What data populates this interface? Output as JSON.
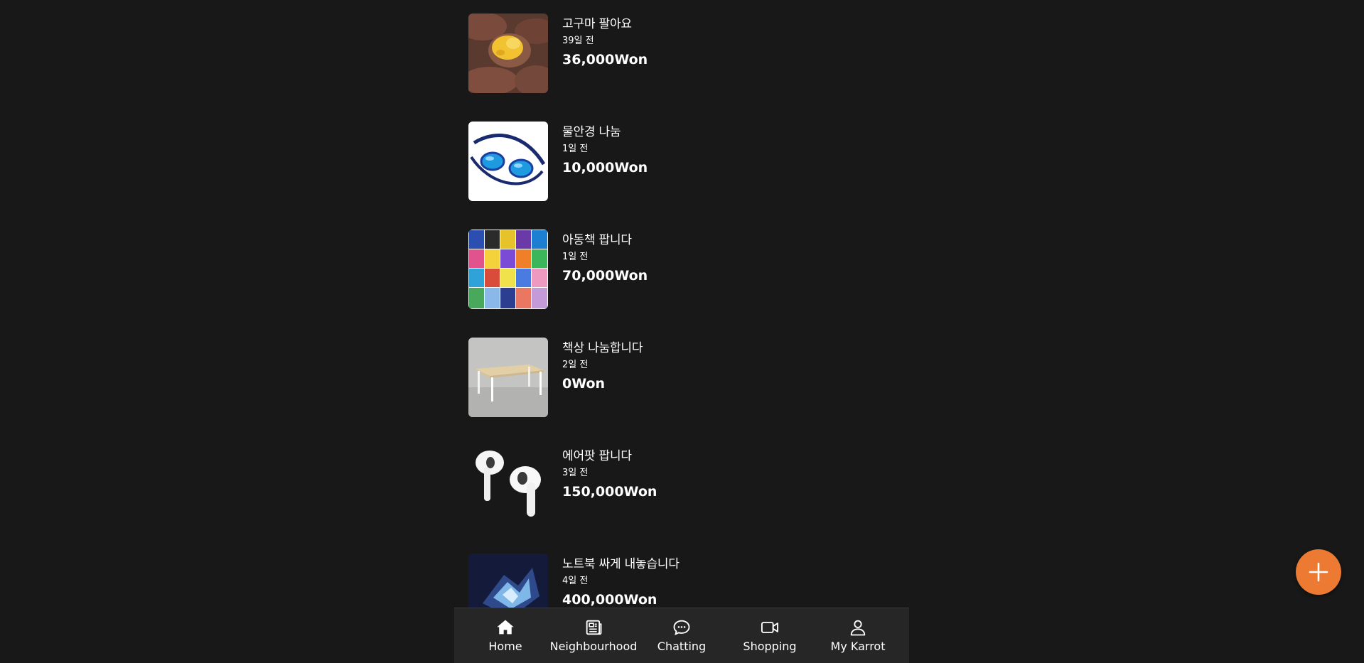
{
  "listings": [
    {
      "title": "고구마 팔아요",
      "age": "39일 전",
      "price": "36,000Won",
      "image": "sweet-potato-image"
    },
    {
      "title": "물안경 나눔",
      "age": "1일 전",
      "price": "10,000Won",
      "image": "swim-goggles-image"
    },
    {
      "title": "아동책 팝니다",
      "age": "1일 전",
      "price": "70,000Won",
      "image": "childrens-books-image"
    },
    {
      "title": "책상 나눔합니다",
      "age": "2일 전",
      "price": "0Won",
      "image": "desk-image"
    },
    {
      "title": "에어팟 팝니다",
      "age": "3일 전",
      "price": "150,000Won",
      "image": "airpods-image"
    },
    {
      "title": "노트북 싸게 내놓습니다",
      "age": "4일 전",
      "price": "400,000Won",
      "image": "laptop-image"
    }
  ],
  "nav": {
    "home": {
      "label": "Home",
      "icon": "home-icon"
    },
    "neighbourhood": {
      "label": "Neighbourhood",
      "icon": "newspaper-icon"
    },
    "chatting": {
      "label": "Chatting",
      "icon": "chat-bubble-icon"
    },
    "shopping": {
      "label": "Shopping",
      "icon": "video-camera-icon"
    },
    "my_karrot": {
      "label": "My Karrot",
      "icon": "user-icon"
    }
  },
  "fab": {
    "icon": "plus-icon",
    "color": "#ec7a33"
  },
  "colors": {
    "background": "#181818",
    "nav_background": "#262626",
    "accent": "#ec7a33"
  }
}
